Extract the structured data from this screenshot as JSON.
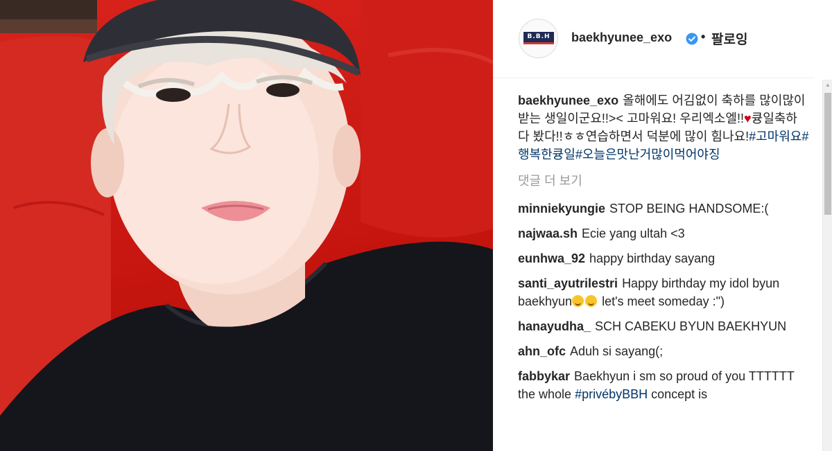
{
  "post": {
    "username": "baekhyunee_exo",
    "follow_separator": "•",
    "follow_label": "팔로잉",
    "avatar_text": "B.B.H",
    "caption_text": "올해에도 어김없이 축하를 많이많이받는 생일이군요!!>< 고마워요! 우리엑소엘!!",
    "caption_text2": "큥일축하 다 봤다!!ㅎㅎ연습하면서 덕분에 많이 힘나요!",
    "hashtags": [
      "#고마워요",
      "#행복한큥일",
      "#오늘은맛난거많이먹어야징"
    ],
    "more_comments_label": "댓글 더 보기"
  },
  "comments": [
    {
      "user": "minniekyungie",
      "text": "STOP BEING HANDSOME:("
    },
    {
      "user": "najwaa.sh",
      "text": "Ecie yang ultah <3"
    },
    {
      "user": "eunhwa_92",
      "text": "happy birthday sayang"
    },
    {
      "user": "santi_ayutrilestri",
      "text": "Happy birthday my idol byun baekhyun",
      "text_after": " let's meet someday :\")"
    },
    {
      "user": "hanayudha_",
      "text": "SCH CABEKU BYUN BAEKHYUN"
    },
    {
      "user": "ahn_ofc",
      "text": "Aduh si sayang(;"
    },
    {
      "user": "fabbykar",
      "text": "Baekhyun i sm so proud of you TTTTTT the whole ",
      "hashtag": "#privébyBBH",
      "text_after": " concept is"
    }
  ],
  "colors": {
    "hashtag": "#003569",
    "verified": "#3897f0",
    "muted": "#999999",
    "background_photo": "#c7150f"
  },
  "icons": [
    "verified-badge-icon",
    "heart-icon",
    "smiley-icon"
  ]
}
